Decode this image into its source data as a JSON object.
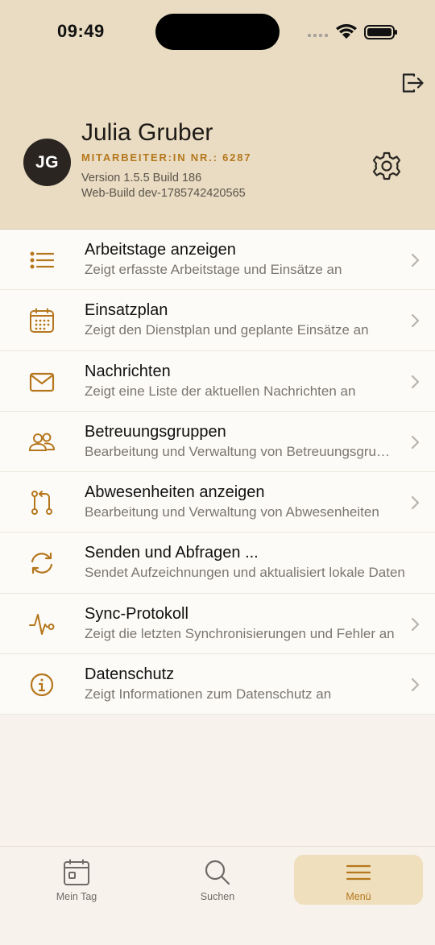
{
  "status_bar": {
    "time": "09:49"
  },
  "profile": {
    "initials": "JG",
    "name": "Julia Gruber",
    "employee_number": "MITARBEITER:IN NR.: 6287",
    "version": "Version 1.5.5 Build 186",
    "web_build": "Web-Build dev-1785742420565"
  },
  "menu": {
    "items": [
      {
        "icon": "list-icon",
        "title": "Arbeitstage anzeigen",
        "subtitle": "Zeigt erfasste Arbeitstage und Einsätze an"
      },
      {
        "icon": "calendar-grid-icon",
        "title": "Einsatzplan",
        "subtitle": "Zeigt den Dienstplan und geplante Einsätze an"
      },
      {
        "icon": "envelope-icon",
        "title": "Nachrichten",
        "subtitle": "Zeigt eine Liste der aktuellen Nachrichten an"
      },
      {
        "icon": "people-icon",
        "title": "Betreuungsgruppen",
        "subtitle": "Bearbeitung und Verwaltung von Betreuungsgruppen"
      },
      {
        "icon": "branch-icon",
        "title": "Abwesenheiten anzeigen",
        "subtitle": "Bearbeitung und Verwaltung von Abwesenheiten"
      },
      {
        "icon": "sync-icon",
        "title": "Senden und Abfragen ...",
        "subtitle": "Sendet Aufzeichnungen und aktualisiert lokale Daten"
      },
      {
        "icon": "activity-icon",
        "title": "Sync-Protokoll",
        "subtitle": "Zeigt die letzten Synchronisierungen und Fehler an"
      },
      {
        "icon": "info-icon",
        "title": "Datenschutz",
        "subtitle": "Zeigt Informationen zum Datenschutz an"
      }
    ]
  },
  "tabbar": {
    "tabs": [
      {
        "label": "Mein Tag",
        "icon": "calendar-icon",
        "active": false
      },
      {
        "label": "Suchen",
        "icon": "search-icon",
        "active": false
      },
      {
        "label": "Menü",
        "icon": "menu-icon",
        "active": true
      }
    ]
  },
  "colors": {
    "accent": "#b5771d",
    "header_bg": "#e9dcc2",
    "avatar_bg": "#2b2522"
  }
}
